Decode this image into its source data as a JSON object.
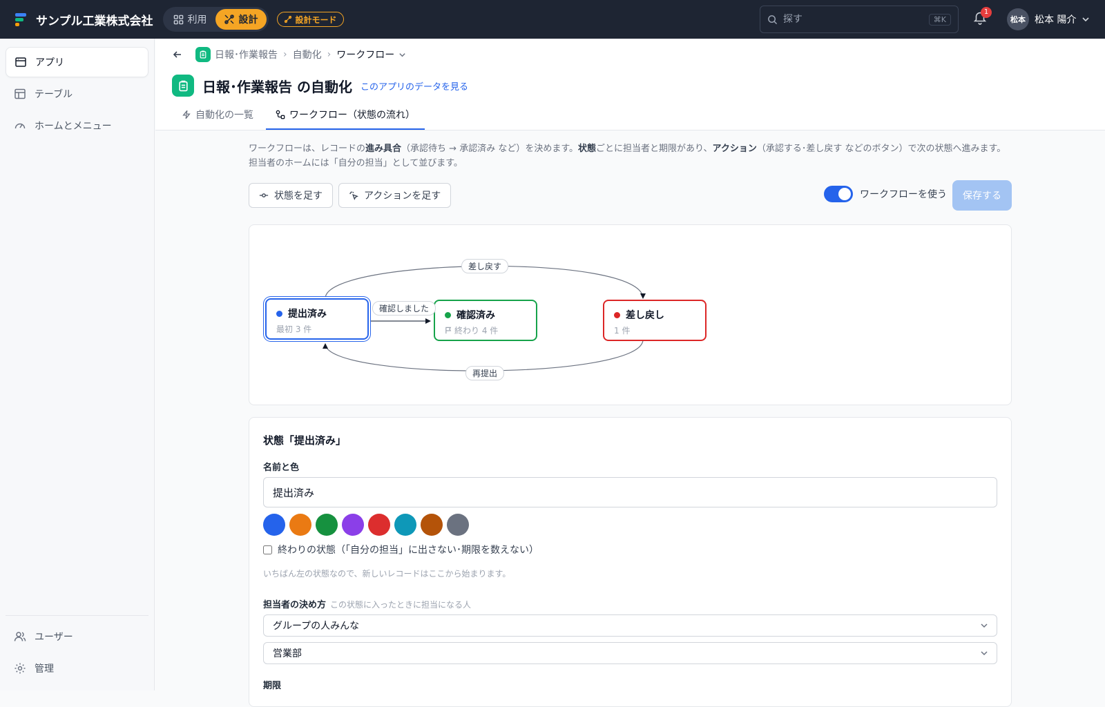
{
  "topbar": {
    "brand": "サンプル工業株式会社",
    "mode_use": "利用",
    "mode_design": "設計",
    "mode_badge": "設計モード",
    "search_placeholder": "探す",
    "search_shortcut": "⌘K",
    "notifications": "1",
    "avatar_initials": "松本",
    "user_name": "松本 陽介"
  },
  "sidebar": {
    "items": [
      {
        "label": "アプリ",
        "icon": "app-window-icon"
      },
      {
        "label": "テーブル",
        "icon": "table-icon"
      },
      {
        "label": "ホームとメニュー",
        "icon": "gauge-icon"
      }
    ],
    "bottom": [
      {
        "label": "ユーザー",
        "icon": "users-icon"
      },
      {
        "label": "管理",
        "icon": "gear-icon"
      }
    ]
  },
  "breadcrumb": {
    "app": "日報･作業報告",
    "section": "自動化",
    "current": "ワークフロー"
  },
  "page": {
    "title": "日報･作業報告 の自動化",
    "data_link": "このアプリのデータを見る"
  },
  "tabs": [
    {
      "label": "自動化の一覧"
    },
    {
      "label": "ワークフロー（状態の流れ）"
    }
  ],
  "description": {
    "p1": "ワークフローは、レコードの",
    "b1": "進み具合",
    "p2": "（承認待ち → 承認済み など）を決めます。",
    "b2": "状態",
    "p3": "ごとに担当者と期限があり、",
    "b3": "アクション",
    "p4": "（承認する･差し戻す などのボタン）で次の状態へ進みます。担当者のホームには「自分の担当」として並びます。"
  },
  "toolbar": {
    "add_state": "状態を足す",
    "add_action": "アクションを足す",
    "toggle_label": "ワークフローを使う",
    "save": "保存する"
  },
  "workflow": {
    "states": [
      {
        "name": "提出済み",
        "meta": "最初  3 件",
        "color": "#2563eb"
      },
      {
        "name": "確認済み",
        "meta": "終わり  4 件",
        "color": "#16a34a"
      },
      {
        "name": "差し戻し",
        "meta": "1 件",
        "color": "#dc2626"
      }
    ],
    "actions": [
      {
        "label": "確認しました"
      },
      {
        "label": "差し戻す"
      },
      {
        "label": "再提出"
      }
    ]
  },
  "detail": {
    "title": "状態「提出済み」",
    "name_label": "名前と色",
    "name_value": "提出済み",
    "colors": [
      "#2563eb",
      "#ea7a13",
      "#16913f",
      "#8b3fe8",
      "#dc2e2e",
      "#0e98b8",
      "#b45309",
      "#6b7280"
    ],
    "end_state_label": "終わりの状態（「自分の担当」に出さない･期限を数えない）",
    "note": "いちばん左の状態なので、新しいレコードはここから始まります。",
    "assignee_label": "担当者の決め方",
    "assignee_hint": "この状態に入ったときに担当になる人",
    "assignee_mode": "グループの人みんな",
    "assignee_group": "営業部",
    "deadline_label": "期限"
  }
}
